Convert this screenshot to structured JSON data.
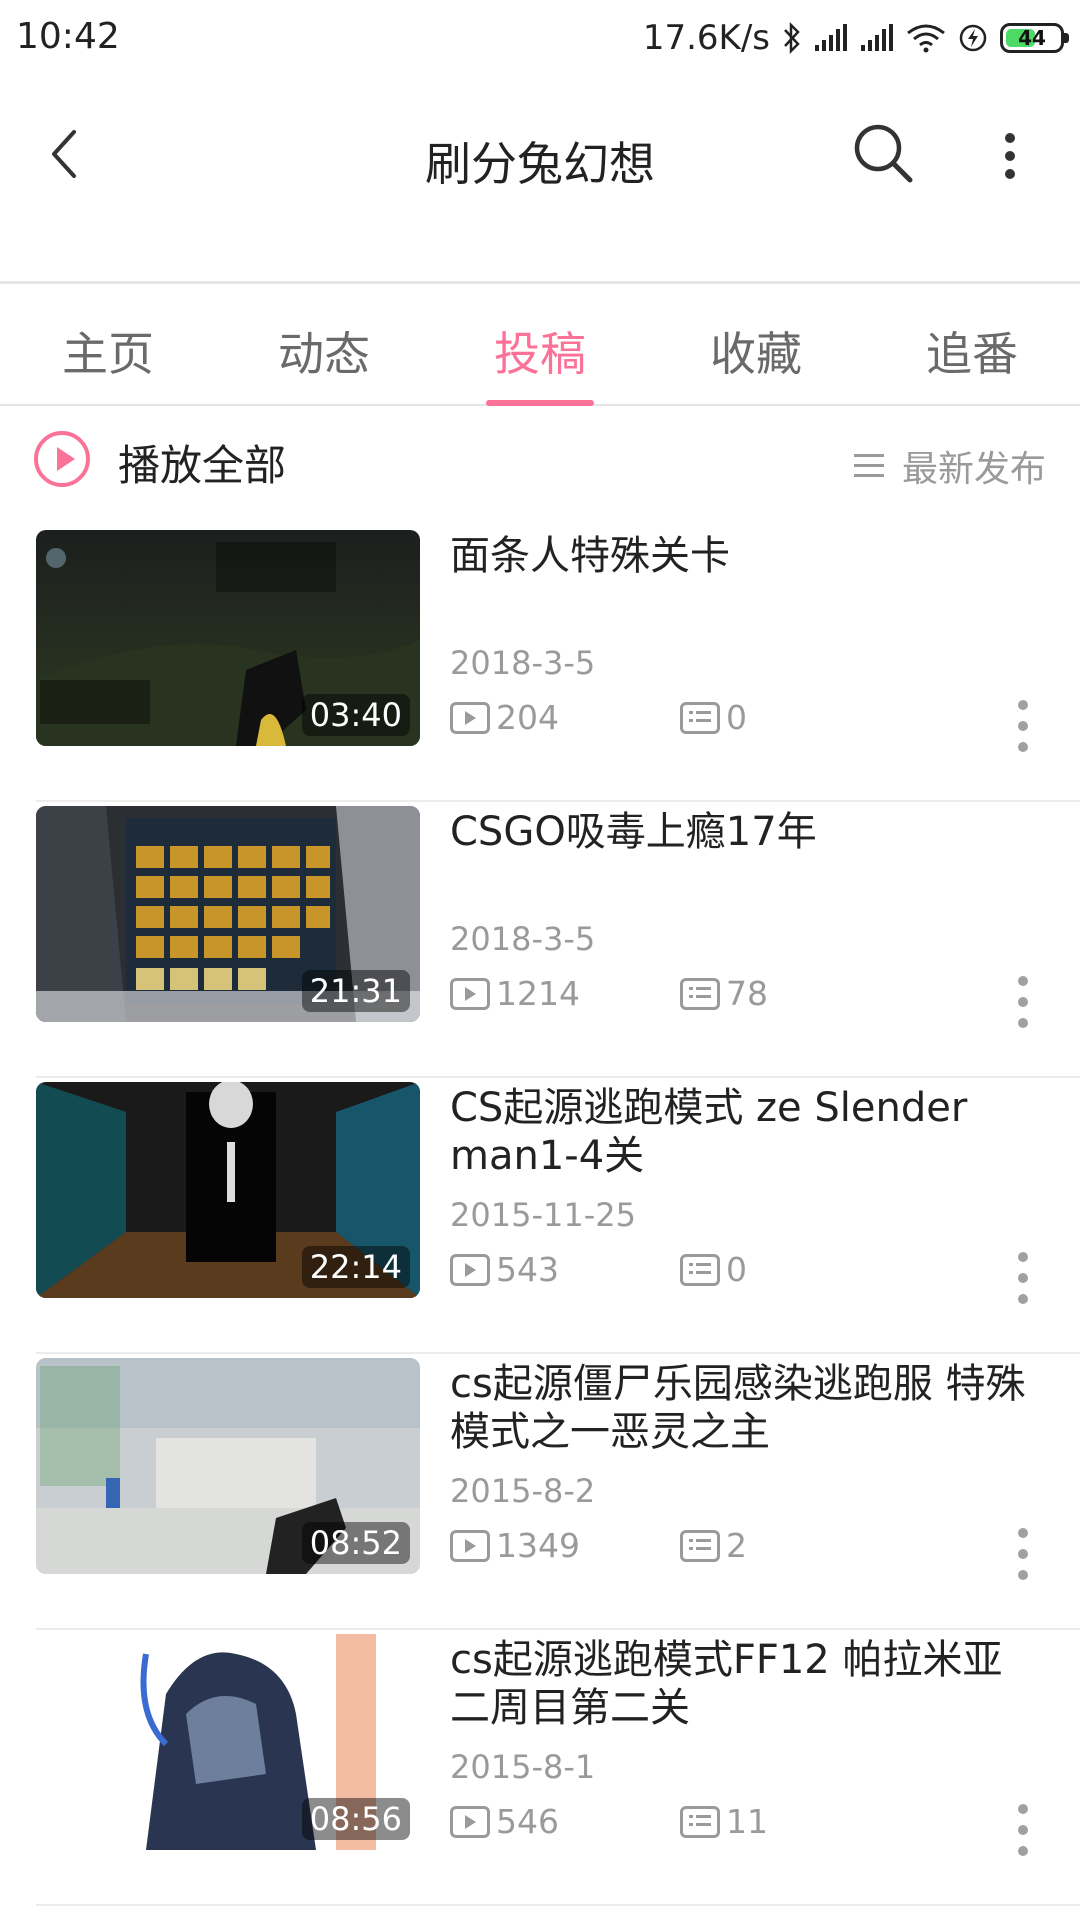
{
  "status_bar": {
    "time": "10:42",
    "speed": "17.6K/s",
    "battery": "44"
  },
  "header": {
    "title": "刷分兔幻想",
    "back_icon": "chevron-left-icon",
    "search_icon": "search-icon",
    "more_icon": "more-vertical-icon"
  },
  "tabs": [
    {
      "label": "主页",
      "active": false
    },
    {
      "label": "动态",
      "active": false
    },
    {
      "label": "投稿",
      "active": true
    },
    {
      "label": "收藏",
      "active": false
    },
    {
      "label": "追番",
      "active": false
    }
  ],
  "play_all": {
    "label": "播放全部",
    "sort_label": "最新发布"
  },
  "accent_color": "#fb7299",
  "videos": [
    {
      "title": "面条人特殊关卡",
      "date": "2018-3-5",
      "plays": "204",
      "danmaku": "0",
      "duration": "03:40"
    },
    {
      "title": "CSGO吸毒上瘾17年",
      "date": "2018-3-5",
      "plays": "1214",
      "danmaku": "78",
      "duration": "21:31"
    },
    {
      "title": "CS起源逃跑模式 ze Slender man1-4关",
      "date": "2015-11-25",
      "plays": "543",
      "danmaku": "0",
      "duration": "22:14"
    },
    {
      "title": "cs起源僵尸乐园感染逃跑服 特殊模式之一恶灵之主",
      "date": "2015-8-2",
      "plays": "1349",
      "danmaku": "2",
      "duration": "08:52"
    },
    {
      "title": "cs起源逃跑模式FF12 帕拉米亚二周目第二关",
      "date": "2015-8-1",
      "plays": "546",
      "danmaku": "11",
      "duration": "08:56"
    }
  ]
}
